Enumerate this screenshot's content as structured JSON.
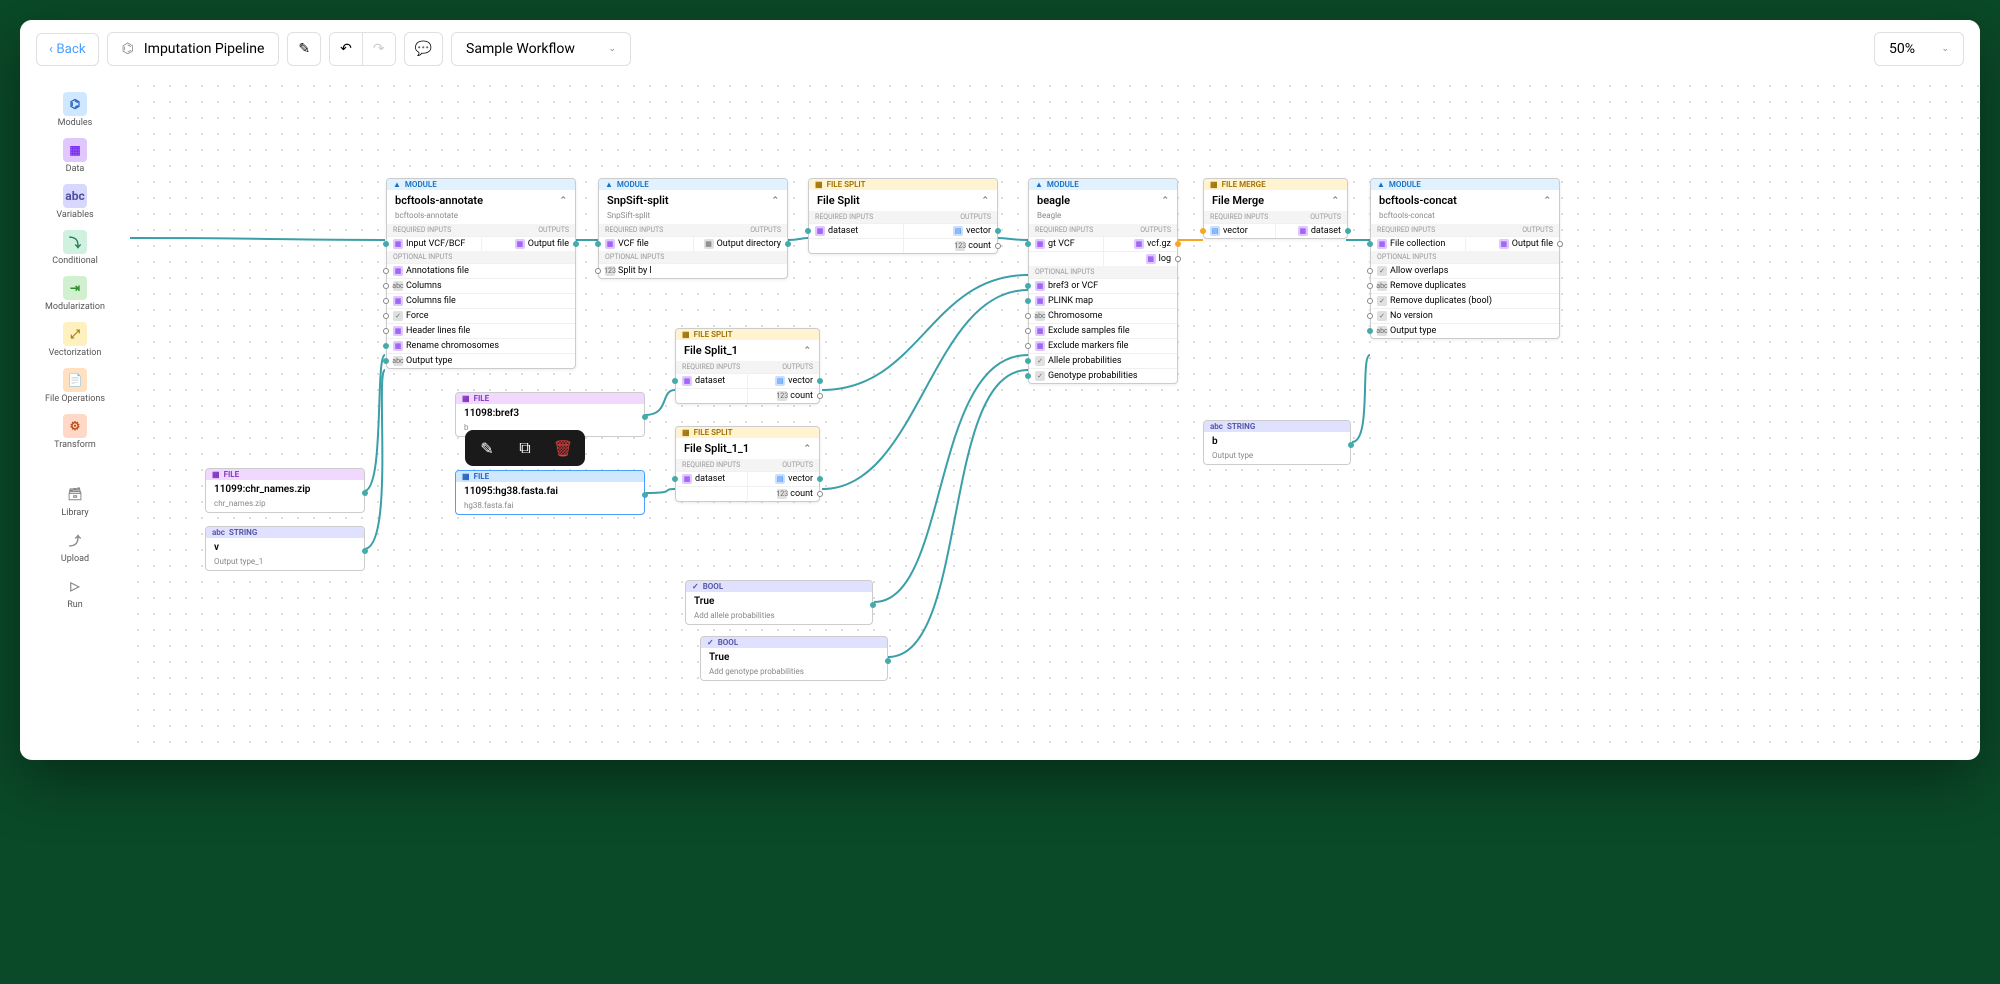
{
  "toolbar": {
    "back": "Back",
    "title": "Imputation Pipeline",
    "workflow": "Sample Workflow",
    "zoom": "50%"
  },
  "sidebar": {
    "modules": "Modules",
    "data": "Data",
    "variables": "Variables",
    "conditional": "Conditional",
    "modularization": "Modularization",
    "vectorization": "Vectorization",
    "fileops": "File Operations",
    "transform": "Transform",
    "library": "Library",
    "upload": "Upload",
    "run": "Run"
  },
  "labels": {
    "module": "MODULE",
    "filesplit": "FILE SPLIT",
    "filemerge": "FILE MERGE",
    "file": "FILE",
    "string": "STRING",
    "bool": "BOOL",
    "req_inputs": "REQUIRED INPUTS",
    "opt_inputs": "OPTIONAL INPUTS",
    "outputs": "OUTPUTS"
  },
  "nodes": {
    "bcftools_annotate": {
      "title": "bcftools-annotate",
      "sub": "bcftools-annotate",
      "inputs": {
        "vcf": "Input VCF/BCF"
      },
      "outputs": {
        "file": "Output file"
      },
      "opt": [
        "Annotations file",
        "Columns",
        "Columns file",
        "Force",
        "Header lines file",
        "Rename chromosomes",
        "Output type"
      ]
    },
    "snpsift": {
      "title": "SnpSift-split",
      "sub": "SnpSift-split",
      "inputs": {
        "vcf": "VCF file"
      },
      "outputs": {
        "dir": "Output directory"
      },
      "opt": [
        "Split by l"
      ]
    },
    "filesplit": {
      "title": "File Split",
      "in": "dataset",
      "out1": "vector",
      "out2": "count"
    },
    "filesplit1": {
      "title": "File Split_1",
      "in": "dataset",
      "out1": "vector",
      "out2": "count"
    },
    "filesplit11": {
      "title": "File Split_1_1",
      "in": "dataset",
      "out1": "vector",
      "out2": "count"
    },
    "beagle": {
      "title": "beagle",
      "sub": "Beagle",
      "inputs": {
        "vcf": "gt VCF"
      },
      "outputs": {
        "vcf": "vcf.gz",
        "log": "log"
      },
      "opt": [
        "bref3 or VCF",
        "PLINK map",
        "Chromosome",
        "Exclude samples file",
        "Exclude markers file",
        "Allele probabilities",
        "Genotype probabilities"
      ]
    },
    "filemerge": {
      "title": "File Merge",
      "in": "vector",
      "out": "dataset"
    },
    "bcftools_concat": {
      "title": "bcftools-concat",
      "sub": "bcftools-concat",
      "inputs": {
        "fc": "File collection"
      },
      "outputs": {
        "file": "Output file"
      },
      "opt": [
        "Allow overlaps",
        "Remove duplicates",
        "Remove duplicates (bool)",
        "No version",
        "Output type"
      ]
    },
    "file_chr": {
      "title": "11099:chr_names.zip",
      "sub": "chr_names.zip"
    },
    "file_bref3": {
      "title": "11098:bref3",
      "sub": "b"
    },
    "file_fasta": {
      "title": "11095:hg38.fasta.fai",
      "sub": "hg38.fasta.fai"
    },
    "string_v": {
      "title": "v",
      "sub": "Output type_1"
    },
    "string_b": {
      "title": "b",
      "sub": "Output type"
    },
    "bool_ap": {
      "title": "True",
      "sub": "Add allele probabilities"
    },
    "bool_gp": {
      "title": "True",
      "sub": "Add genotype probabilities"
    }
  }
}
